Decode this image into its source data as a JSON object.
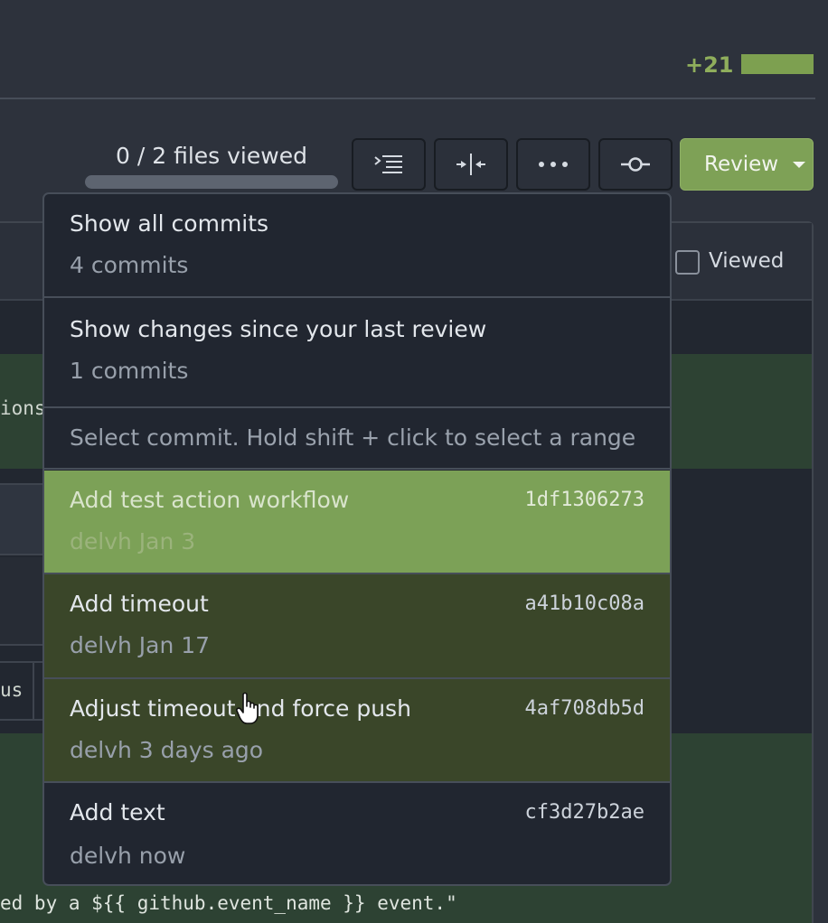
{
  "header": {
    "diff_additions": "+21",
    "files_viewed": "0 / 2 files viewed",
    "files_viewed_progress": 0,
    "review_button": "Review",
    "toolbar_icons": [
      "file-tree-icon",
      "split-diff-icon",
      "kebab-horizontal-icon",
      "git-commit-icon"
    ]
  },
  "file": {
    "viewed_label": "Viewed",
    "viewed_checked": false,
    "code_fragments": [
      "ions",
      "us",
      "ed by a ${{ github.event_name }} event.\""
    ]
  },
  "commit_menu": {
    "show_all": {
      "title": "Show all commits",
      "sub": "4 commits"
    },
    "since_review": {
      "title": "Show changes since your last review",
      "sub": "1 commits"
    },
    "hint": "Select commit. Hold shift + click to select a range",
    "commits": [
      {
        "title": "Add test action workflow",
        "author_date": "delvh Jan 3",
        "sha": "1df1306273",
        "state": "selected"
      },
      {
        "title": "Add timeout",
        "author_date": "delvh Jan 17",
        "sha": "a41b10c08a",
        "state": "in-range"
      },
      {
        "title": "Adjust timeout and force push",
        "author_date": "delvh 3 days ago",
        "sha": "4af708db5d",
        "state": "in-range"
      },
      {
        "title": "Add text",
        "author_date": "delvh now",
        "sha": "cf3d27b2ae",
        "state": "default"
      }
    ]
  },
  "colors": {
    "accent_green": "#7ca157",
    "range_green": "#3a4629",
    "added_code_bg": "#2d4233",
    "background": "#2d323c"
  }
}
